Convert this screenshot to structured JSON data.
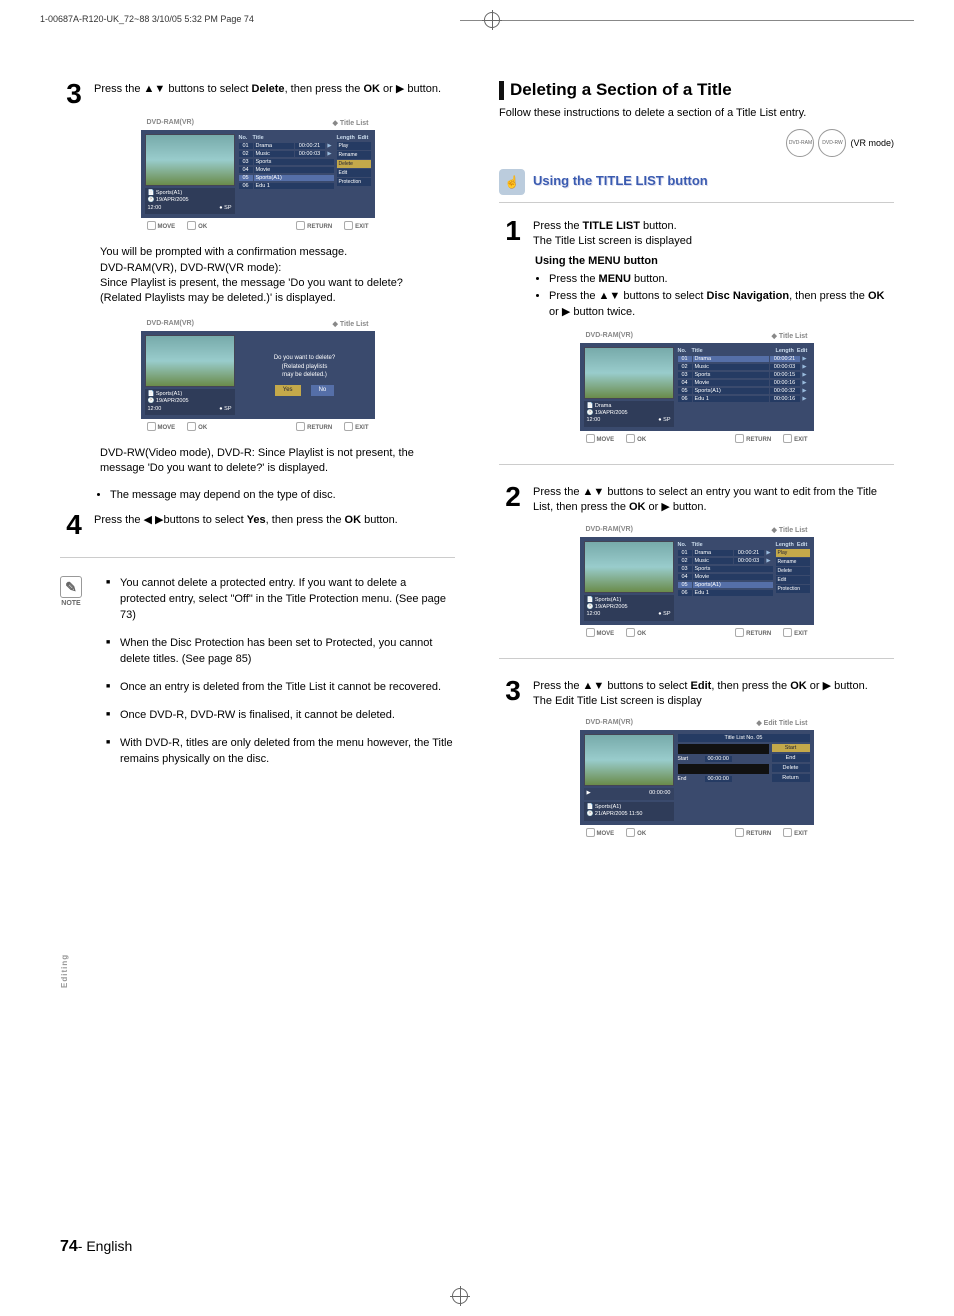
{
  "print_header": "1-00687A-R120-UK_72~88  3/10/05  5:32 PM  Page 74",
  "side_label": "Editing",
  "footer_page": "74",
  "footer_text": "- English",
  "left": {
    "step3": {
      "text_a": "Press the ",
      "btns": "▲▼",
      "text_b": " buttons to select ",
      "bold1": "Delete",
      "text_c": ", then press the ",
      "bold2": "OK",
      "text_d": " or ",
      "play": "▶",
      "text_e": " button."
    },
    "step3_body1": "You will be prompted with a confirmation message.",
    "step3_body2": "DVD-RAM(VR), DVD-RW(VR mode):",
    "step3_body3": "Since Playlist is present, the message 'Do you want to delete?(Related Playlists may be deleted.)' is displayed.",
    "step3_body4": "DVD-RW(Video mode), DVD-R: Since Playlist is not present, the message 'Do you want to delete?' is displayed.",
    "step3_bullet": "The message may depend on the type of disc.",
    "step4": {
      "text_a": "Press the ",
      "btns": "◀ ▶",
      "text_b": "buttons to select ",
      "bold1": "Yes",
      "text_c": ", then press the ",
      "bold2": "OK",
      "text_d": " button."
    },
    "note_label": "NOTE",
    "notes": [
      "You cannot delete a protected entry. If you want to delete a protected entry, select \"Off\" in the Title Protection menu. (See page 73)",
      "When the Disc Protection has been set to Protected, you cannot delete titles. (See page 85)",
      "Once an entry is deleted from the Title List it cannot be recovered.",
      "Once DVD-R, DVD-RW is finalised, it cannot be deleted.",
      "With DVD-R, titles are only deleted from the menu however, the Title remains physically on the disc."
    ]
  },
  "right": {
    "section_title": "Deleting a Section of a Title",
    "intro": "Follow these instructions to delete a section of a Title List entry.",
    "vr_mode": "(VR mode)",
    "chip1": "DVD-RAM",
    "chip2": "DVD-RW",
    "sub_h": "Using the TITLE LIST button",
    "step1": {
      "a": "Press the ",
      "b": "TITLE LIST",
      "c": " button.",
      "d": "The Title List screen is displayed"
    },
    "using_menu": "Using the MENU button",
    "menu_b1_a": "Press the ",
    "menu_b1_b": "MENU",
    "menu_b1_c": " button.",
    "menu_b2_a": "Press the ",
    "menu_b2_btns": "▲▼",
    "menu_b2_b": " buttons to select ",
    "menu_b2_bold": "Disc Navigation",
    "menu_b2_c": ", then press the ",
    "menu_b2_ok": "OK",
    "menu_b2_d": " or ",
    "menu_b2_play": "▶",
    "menu_b2_e": " button twice.",
    "step2": {
      "a": "Press the ",
      "btns": "▲▼",
      "b": " buttons to select an entry you want to edit from the Title List, then press the ",
      "ok": "OK",
      "c": " or ",
      "play": "▶",
      "d": " button."
    },
    "step3": {
      "a": "Press the ",
      "btns": "▲▼",
      "b": " buttons to select ",
      "bold": "Edit",
      "c": ", then press the ",
      "ok": "OK",
      "d": " or ",
      "play": "▶",
      "e": " button.",
      "f": "The Edit Title List screen is display"
    }
  },
  "screens": {
    "common": {
      "hdr_left": "DVD-RAM(VR)",
      "hdr_title_list": "Title List",
      "hdr_edit_title_list": "Edit Title List",
      "ftr_move": "MOVE",
      "ftr_ok": "OK",
      "ftr_return": "RETURN",
      "ftr_exit": "EXIT",
      "col_no": "No.",
      "col_title": "Title",
      "col_length": "Length",
      "col_edit": "Edit"
    },
    "s1": {
      "info1": "Sports(A1)",
      "info2": "19/APR/2005",
      "info3": "12:00",
      "info_sp": "SP",
      "rows": [
        {
          "n": "01",
          "t": "Drama",
          "l": "00:00:21"
        },
        {
          "n": "02",
          "t": "Music",
          "l": "00:00:03"
        },
        {
          "n": "03",
          "t": "Sports",
          "l": ""
        },
        {
          "n": "04",
          "t": "Movie",
          "l": ""
        },
        {
          "n": "05",
          "t": "Sports(A1)",
          "l": ""
        },
        {
          "n": "06",
          "t": "Edu 1",
          "l": ""
        }
      ],
      "edits": [
        "Play",
        "Rename",
        "Delete",
        "Edit",
        "Protection"
      ]
    },
    "dialog": {
      "line1": "Do you want to delete?",
      "line2": "(Related playlists",
      "line3": "may be deleted.)",
      "yes": "Yes",
      "no": "No",
      "info1": "Sports(A1)",
      "info2": "19/APR/2005",
      "info3": "12:00",
      "info_sp": "SP"
    },
    "r1": {
      "info1": "Drama",
      "info2": "19/APR/2005",
      "info3": "12:00",
      "info_sp": "SP",
      "rows": [
        {
          "n": "01",
          "t": "Drama",
          "l": "00:00:21"
        },
        {
          "n": "02",
          "t": "Music",
          "l": "00:00:03"
        },
        {
          "n": "03",
          "t": "Sports",
          "l": "00:00:15"
        },
        {
          "n": "04",
          "t": "Movie",
          "l": "00:00:16"
        },
        {
          "n": "05",
          "t": "Sports(A1)",
          "l": "00:00:32"
        },
        {
          "n": "06",
          "t": "Edu 1",
          "l": "00:00:16"
        }
      ]
    },
    "r2": {
      "info1": "Sports(A1)",
      "info2": "19/APR/2005",
      "info3": "12:00",
      "info_sp": "SP",
      "rows": [
        {
          "n": "01",
          "t": "Drama",
          "l": "00:00:21"
        },
        {
          "n": "02",
          "t": "Music",
          "l": "00:00:03"
        },
        {
          "n": "03",
          "t": "Sports",
          "l": ""
        },
        {
          "n": "04",
          "t": "Movie",
          "l": ""
        },
        {
          "n": "05",
          "t": "Sports(A1)",
          "l": ""
        },
        {
          "n": "06",
          "t": "Edu 1",
          "l": ""
        }
      ],
      "edits": [
        "Play",
        "Rename",
        "Delete",
        "Edit",
        "Protection"
      ]
    },
    "r3": {
      "header_sub": "Title List No. 05",
      "start_lbl": "Start",
      "start_val": "00:00:00",
      "end_lbl": "End",
      "end_val": "00:00:00",
      "progress": "00:00:00",
      "info1": "Sports(A1)",
      "info2": "21/APR/2005 11:50",
      "btns": [
        "Start",
        "End",
        "Delete",
        "Return"
      ]
    }
  }
}
